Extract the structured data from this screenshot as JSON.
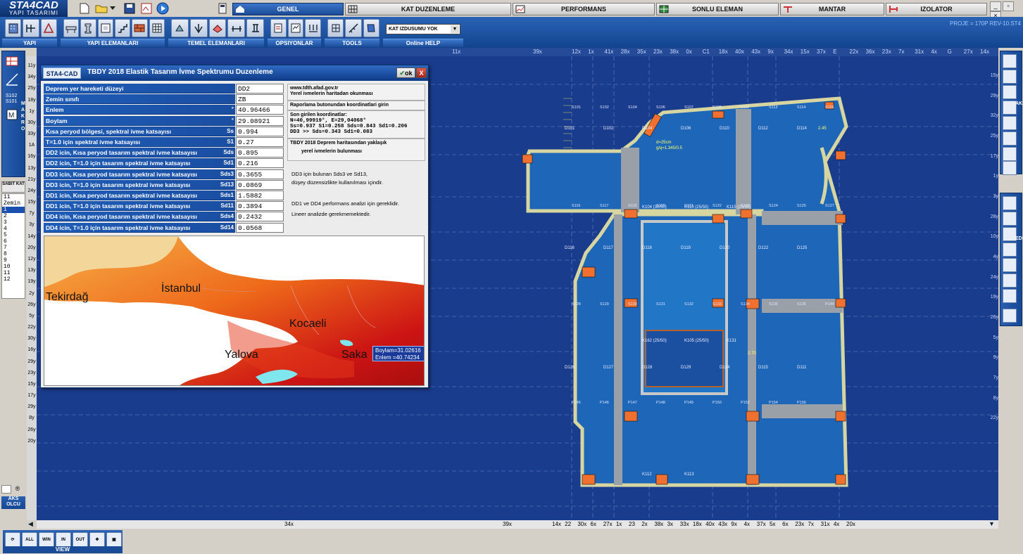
{
  "app": {
    "logo_main": "STA4CAD",
    "logo_sub": "YAPI TASARIMI",
    "project": "PROJE = 170P REV-10.ST4"
  },
  "main_tabs": [
    {
      "label": "GENEL",
      "active": true
    },
    {
      "label": "KAT DUZENLEME",
      "active": false
    },
    {
      "label": "PERFORMANS",
      "active": false
    },
    {
      "label": "SONLU ELEMAN",
      "active": false
    },
    {
      "label": "MANTAR",
      "active": false
    },
    {
      "label": "IZOLATOR",
      "active": false
    }
  ],
  "toolbar": {
    "groups": [
      "YAPI",
      "YAPI ELEMANLARI",
      "TEMEL ELEMANLARI",
      "OPSIYONLAR",
      "TOOLS",
      "Online HELP"
    ],
    "kat_select": "KAT IZDUSUMU YOK",
    "view_label": "VIEW",
    "view_buttons": [
      "ALL",
      "WIN",
      "IN",
      "OUT"
    ]
  },
  "left_panel": {
    "makro_label": "MAKRO",
    "sabit_label": "SABIT KAT",
    "floors": [
      "11",
      "Zemin",
      "1",
      "2",
      "3",
      "4",
      "5",
      "6",
      "7",
      "8",
      "9",
      "10",
      "11",
      "12"
    ],
    "selected_floor_index": 2,
    "aks_label": "AKS OLCU"
  },
  "right_panel": {
    "labels": [
      "AKS",
      "EDIT"
    ]
  },
  "ruler_top": [
    "11x",
    "39x",
    "12x",
    "1x",
    "41x",
    "28x",
    "35x",
    "23x",
    "38x",
    "0x",
    "C1",
    "18x",
    "40x",
    "43x",
    "9x",
    "34x",
    "15x",
    "37x",
    "E",
    "22x",
    "36x",
    "23x",
    "7x",
    "31x",
    "4x",
    "G",
    "27x",
    "14x"
  ],
  "ruler_bottom": [
    "34x",
    "39x",
    "14x",
    "22",
    "30x",
    "6x",
    "27x",
    "1x",
    "23",
    "2x",
    "38x",
    "3x",
    "33x",
    "18x",
    "40x",
    "43x",
    "9x",
    "4x",
    "37x",
    "5x",
    "6x",
    "23x",
    "7x",
    "31x",
    "4x",
    "20x"
  ],
  "ruler_left": [
    "11y",
    "34y",
    "25y",
    "18y",
    "1y",
    "30y",
    "33y",
    "1A",
    "16y",
    "13y",
    "21y",
    "24y",
    "15y",
    "7y",
    "3y",
    "14y",
    "20y",
    "12y",
    "13y",
    "19y",
    "2y",
    "26y",
    "5y",
    "22y",
    "30y",
    "16y",
    "29y",
    "23y",
    "15y",
    "17y",
    "29y",
    "8y",
    "26y",
    "20y"
  ],
  "ruler_right": [
    "15y",
    "29y",
    "32y",
    "25y",
    "17y",
    "1y",
    "3y",
    "28y",
    "10y",
    "4y",
    "24y",
    "19y",
    "26y",
    "5y",
    "9y",
    "7y",
    "8y",
    "22y"
  ],
  "dialog": {
    "badge": "STA4-CAD",
    "title": "TBDY 2018 Elastik Tasarım İvme Spektrumu Duzenleme",
    "ok_label": "ok",
    "close_label": "X",
    "params": [
      {
        "label": "Deprem yer hareketi düzeyi",
        "symbol": "",
        "value": "DD2"
      },
      {
        "label": "Zemin sınıfı",
        "symbol": "",
        "value": "ZB"
      },
      {
        "label": "Enlem",
        "symbol": "°",
        "value": "40.96466"
      },
      {
        "label": "Boylam",
        "symbol": "°",
        "value": "29.08921"
      },
      {
        "label": "Kısa peryod bölgesi, spektral ivme katsayısı",
        "symbol": "Ss",
        "value": "0.994"
      },
      {
        "label": "T=1.0 için spektral ivme katsayısı",
        "symbol": "S1",
        "value": "0.27"
      },
      {
        "label": "DD2 icin, Kısa peryod tasarım spektral ivme katsayısı",
        "symbol": "Sds",
        "value": "0.895"
      },
      {
        "label": "DD2 icin, T=1.0 için tasarım spektral ivme katsayısı",
        "symbol": "Sd1",
        "value": "0.216"
      },
      {
        "label": "DD3 icin, Kısa peryod tasarım spektral ivme katsayısı",
        "symbol": "Sds3",
        "value": "0.3655"
      },
      {
        "label": "DD3 icin, T=1.0 için tasarım spektral ivme katsayısı",
        "symbol": "Sd13",
        "value": "0.0869"
      },
      {
        "label": "DD1 icin, Kısa peryod tasarım spektral ivme katsayısı",
        "symbol": "Sds1",
        "value": "1.5882"
      },
      {
        "label": "DD1 icin, T=1.0 için tasarım spektral ivme katsayısı",
        "symbol": "Sd11",
        "value": "0.3894"
      },
      {
        "label": "DD4 icin, Kısa peryod tasarım spektral ivme katsayısı",
        "symbol": "Sds4",
        "value": "0.2432"
      },
      {
        "label": "DD4 icin, T=1.0 için tasarım spektral ivme katsayısı",
        "symbol": "Sd14",
        "value": "0.0568"
      }
    ],
    "info": {
      "url": "www.tdth.afad.gov.tr",
      "url_note": "Yerel ivmelerin haritadan okunması",
      "raporlama": "Raporlama butonundan koordinatlari girin",
      "last_coords_title": "Son girilen koordinatlar:",
      "last_coords": "N=40,99919°,   E=29,04068°",
      "coords_line2": "Ss=0.937  S1=0.258  Sds=0.843  Sd1=0.206",
      "coords_line3": "DD3  >>                  Sds=0.343  Sd1=0.083",
      "tbdy_title": "TBDY 2018 Deprem haritasından yaklaşık",
      "tbdy_sub": "yerel ivmelerin bulunması",
      "dd3_note1": "DD3 için bulunan Sds3 ve Sd13,",
      "dd3_note2": "düşey düzensizlikte kullanılması içindir.",
      "dd1_note": "DD1 ve DD4 performans analizi için gereklidir.",
      "lineer_note": "Lineer analizde gerekmemektedir."
    },
    "map": {
      "cities": [
        "Tekirdağ",
        "İstanbul",
        "Kocaeli",
        "Yalova",
        "Saka"
      ],
      "boylam_readout": "Boylam=31.02616",
      "enlem_readout": "Enlem  =40.74234"
    }
  },
  "plan_labels": {
    "slabs": [
      "D101",
      "D102",
      "D104",
      "D106",
      "D110",
      "D112",
      "D114",
      "D116",
      "D117",
      "D118",
      "D119",
      "D120",
      "D122",
      "D125",
      "D126",
      "D127",
      "D128",
      "D129",
      "D134",
      "D115",
      "D111"
    ],
    "beams": [
      "K104 (30/50)",
      "K110 (25/50)",
      "K115 (25/50)",
      "K162 (25/50)",
      "K105 (25/50)",
      "K131",
      "K112",
      "K113"
    ],
    "columns": [
      "S101",
      "S102",
      "S104",
      "S106",
      "S107",
      "S108",
      "S111",
      "S113",
      "S114",
      "S115",
      "S116",
      "S117",
      "S118",
      "S120",
      "S121",
      "S122",
      "S123",
      "S124",
      "S125",
      "S127",
      "S128",
      "S129",
      "S130",
      "S131",
      "S132",
      "S133",
      "S134",
      "S135",
      "S136",
      "P144",
      "P145",
      "P146",
      "P147",
      "P148",
      "P149",
      "P150",
      "P152",
      "P154",
      "P156"
    ],
    "slab_note": "d=25cm",
    "load_note": "g/q=1.345/0.5",
    "dim_245": "2.45",
    "dim_270": "2.70"
  }
}
